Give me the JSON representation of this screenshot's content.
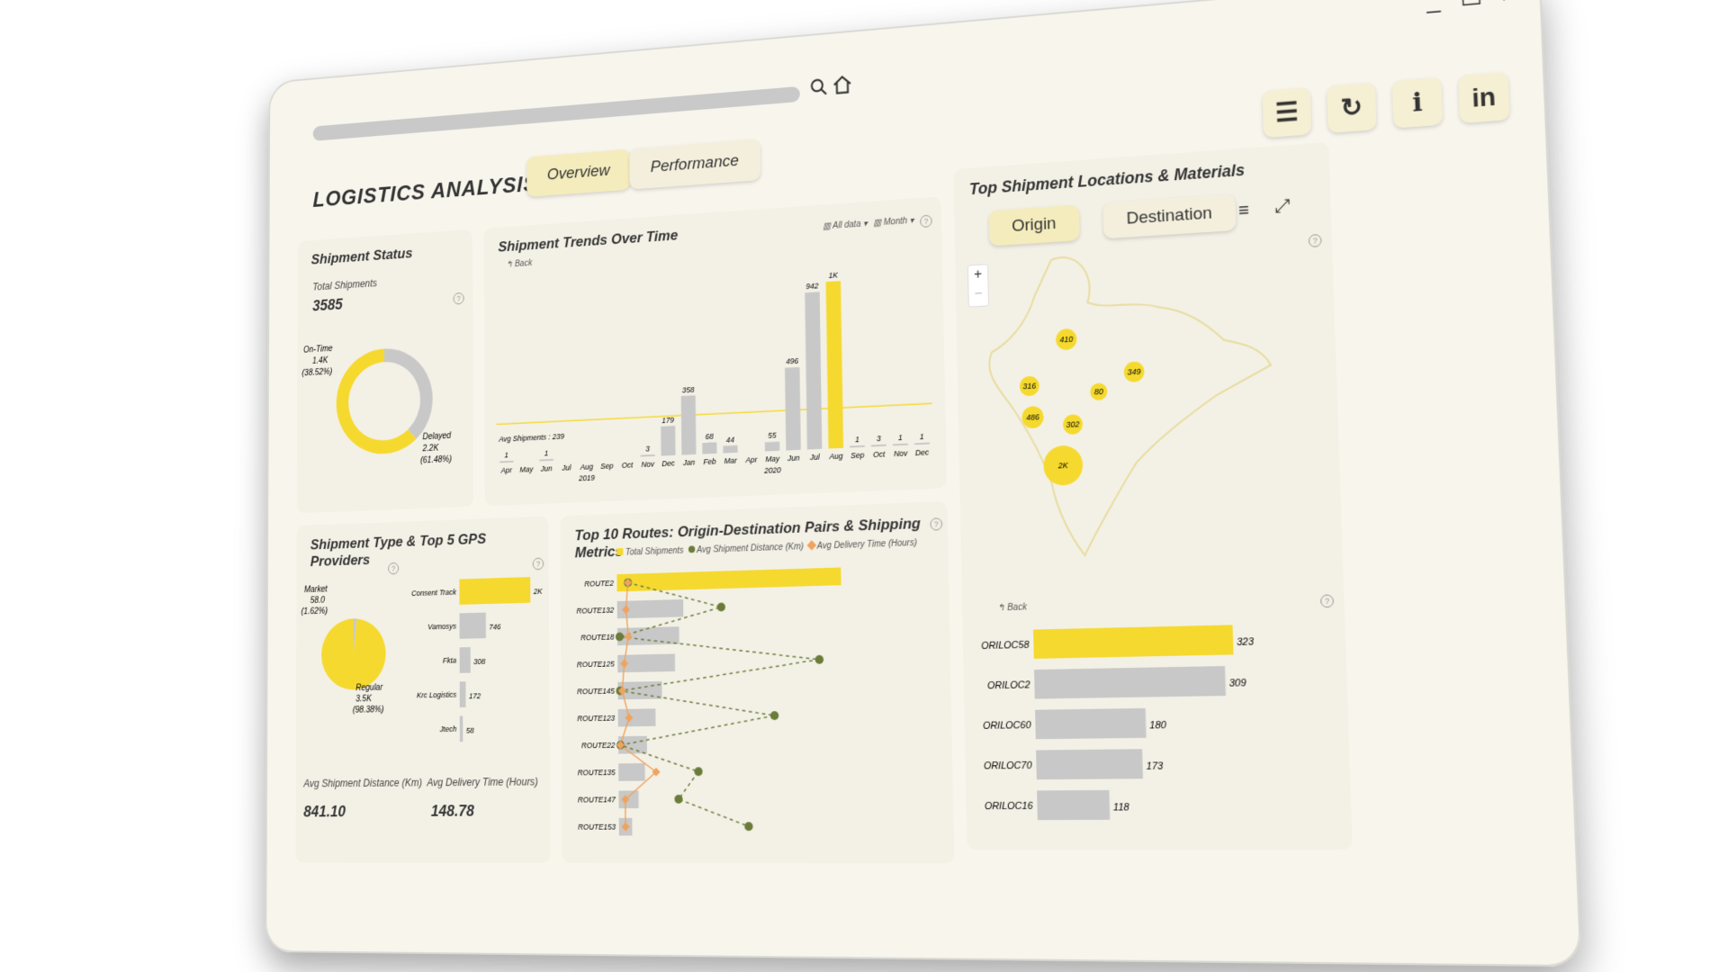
{
  "window": {
    "minimize_glyph": "_",
    "maximize_glyph": "☐",
    "close_glyph": "✕"
  },
  "app": {
    "title": "LOGISTICS ANALYSIS",
    "tabs": [
      "Overview",
      "Performance"
    ],
    "active_tab": "Overview",
    "tools": [
      {
        "icon": "filter-sliders-icon",
        "glyph": "☰"
      },
      {
        "icon": "refresh-icon",
        "glyph": "↻"
      },
      {
        "icon": "info-icon",
        "glyph": "i"
      },
      {
        "icon": "linkedin-icon",
        "glyph": "in"
      }
    ]
  },
  "status": {
    "title": "Shipment Status",
    "total_label": "Total Shipments",
    "total_value": "3585",
    "chart_data": {
      "type": "pie",
      "slices": [
        {
          "label": "On-Time",
          "value_text": "1.4K",
          "pct_text": "(38.52%)",
          "pct": 38.52,
          "color": "#c8c8c8"
        },
        {
          "label": "Delayed",
          "value_text": "2.2K",
          "pct_text": "(61.48%)",
          "pct": 61.48,
          "color": "#f5d92e"
        }
      ]
    }
  },
  "trends": {
    "title": "Shipment Trends Over Time",
    "back_label": "Back",
    "filter_all": "All data",
    "filter_month": "Month",
    "avg_label": "Avg Shipments : 239",
    "chart_data": {
      "type": "bar",
      "avg": 239,
      "ylim": [
        0,
        1100
      ],
      "categories": [
        "Apr",
        "May",
        "Jun",
        "Jul",
        "Aug",
        "Sep",
        "Oct",
        "Nov",
        "Dec",
        "Jan",
        "Feb",
        "Mar",
        "Apr",
        "May",
        "Jun",
        "Jul",
        "Aug",
        "Sep",
        "Oct",
        "Nov",
        "Dec"
      ],
      "values": [
        1,
        0,
        1,
        0,
        0,
        0,
        0,
        3,
        179,
        358,
        68,
        44,
        0,
        55,
        496,
        942,
        1000,
        1,
        3,
        1,
        1
      ],
      "labels": [
        "1",
        "",
        "1",
        "",
        "",
        "",
        "",
        "3",
        "179",
        "358",
        "68",
        "44",
        "",
        "55",
        "496",
        "942",
        "1K",
        "1",
        "3",
        "1",
        "1"
      ],
      "highlight_index": 16,
      "years": [
        {
          "label": "2019",
          "at": 4
        },
        {
          "label": "2020",
          "at": 13
        }
      ]
    }
  },
  "locations": {
    "title": "Top Shipment Locations & Materials",
    "tabs": [
      "Origin",
      "Destination"
    ],
    "active_tab": "Origin",
    "zoom_in": "+",
    "zoom_out": "−",
    "map_bubbles": [
      {
        "label": "410",
        "value": 410
      },
      {
        "label": "316",
        "value": 316
      },
      {
        "label": "80",
        "value": 80
      },
      {
        "label": "349",
        "value": 349
      },
      {
        "label": "486",
        "value": 486
      },
      {
        "label": "302",
        "value": 302
      },
      {
        "label": "2K",
        "value": 2000
      }
    ],
    "back_label": "Back",
    "chart_data": {
      "type": "bar",
      "orientation": "horizontal",
      "categories": [
        "ORILOC58",
        "ORILOC2",
        "ORILOC60",
        "ORILOC70",
        "ORILOC16"
      ],
      "values": [
        323,
        309,
        180,
        173,
        118
      ]
    }
  },
  "shiptype": {
    "title": "Shipment Type & Top 5 GPS Providers",
    "pie": {
      "type": "pie",
      "slices": [
        {
          "label": "Market",
          "value_text": "58.0",
          "pct_text": "(1.62%)",
          "pct": 1.62,
          "color": "#c8c8c8"
        },
        {
          "label": "Regular",
          "value_text": "3.5K",
          "pct_text": "(98.38%)",
          "pct": 98.38,
          "color": "#f5d92e"
        }
      ]
    },
    "gps": {
      "type": "bar",
      "orientation": "horizontal",
      "categories": [
        "Consent Track",
        "Vamosys",
        "Fkta",
        "Krc Logistics",
        "Jtech"
      ],
      "values": [
        2000,
        746,
        308,
        172,
        58
      ],
      "labels": [
        "2K",
        "746",
        "308",
        "172",
        "58"
      ]
    },
    "kpis": [
      {
        "label": "Avg Shipment Distance (Km)",
        "value": "841.10"
      },
      {
        "label": "Avg Delivery Time (Hours)",
        "value": "148.78"
      }
    ]
  },
  "routes": {
    "title": "Top 10 Routes: Origin-Destination Pairs & Shipping Metrics",
    "legend": [
      {
        "name": "Total Shipments",
        "color": "#f5d92e"
      },
      {
        "name": "Avg Shipment Distance (Km)",
        "color": "#6b7c3a"
      },
      {
        "name": "Avg Delivery Time (Hours)",
        "color": "#f0a35e"
      }
    ],
    "chart_data": {
      "type": "bar",
      "categories": [
        "ROUTE2",
        "ROUTE132",
        "ROUTE18",
        "ROUTE125",
        "ROUTE145",
        "ROUTE123",
        "ROUTE22",
        "ROUTE135",
        "ROUTE147",
        "ROUTE153"
      ],
      "series": [
        {
          "name": "Total Shipments",
          "values": [
            100,
            30,
            28,
            26,
            20,
            17,
            13,
            12,
            9,
            6
          ]
        },
        {
          "name": "Avg Shipment Distance (Km)",
          "values": [
            5,
            47,
            1,
            90,
            1,
            70,
            1,
            36,
            27,
            58
          ]
        },
        {
          "name": "Avg Delivery Time (Hours)",
          "values": [
            5,
            4,
            5,
            3,
            2,
            5,
            1,
            17,
            3,
            3
          ]
        }
      ]
    }
  }
}
